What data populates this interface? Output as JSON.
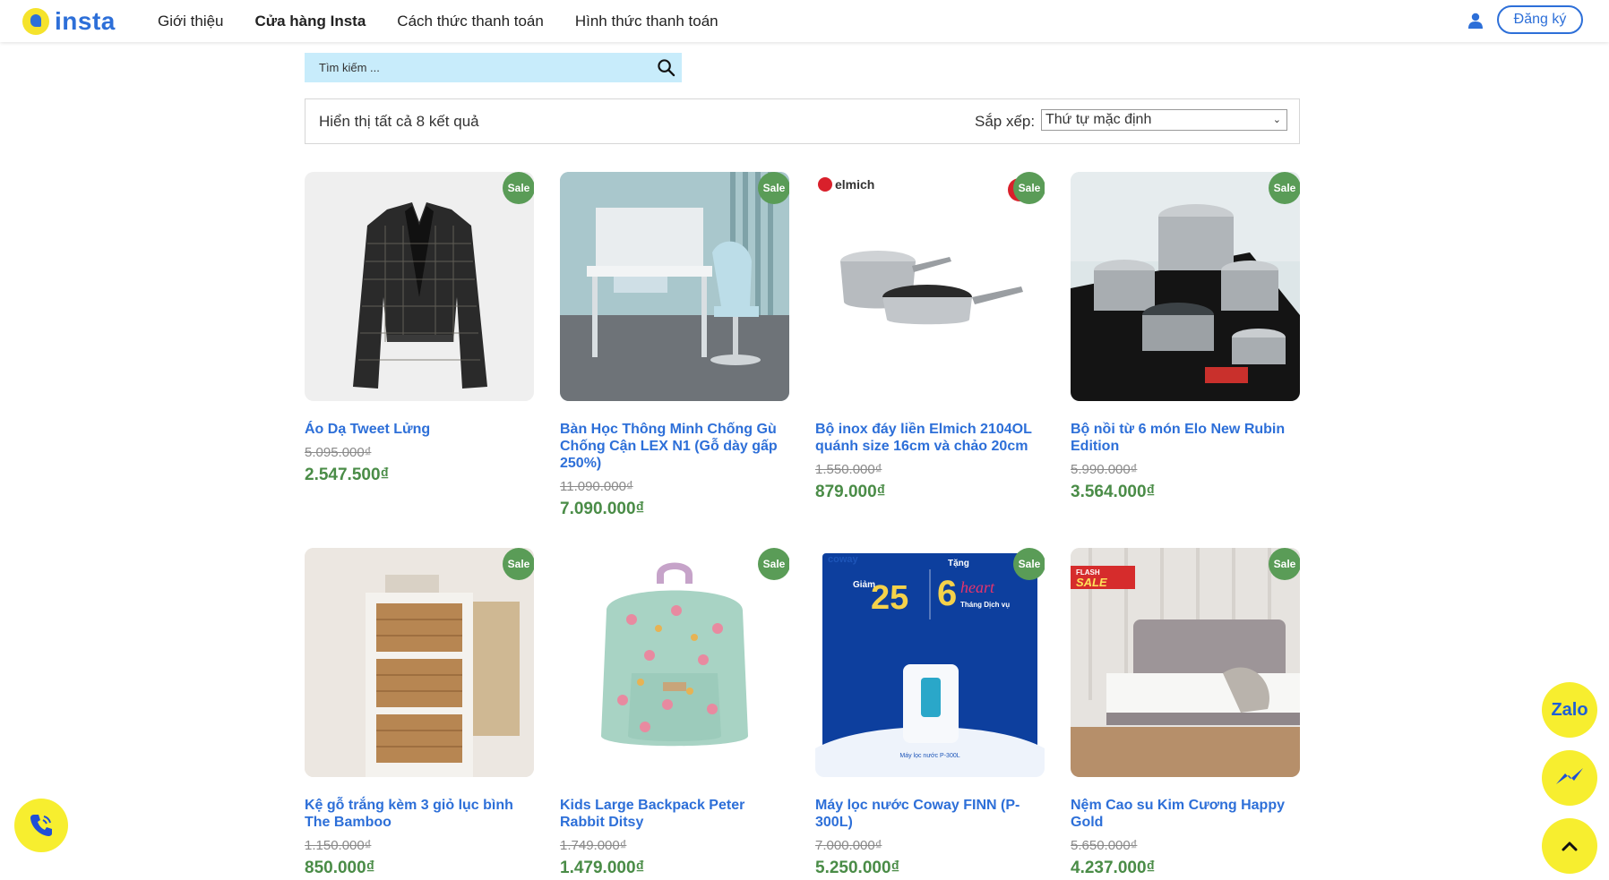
{
  "header": {
    "logo_text": "insta",
    "nav": [
      "Giới thiệu",
      "Cửa hàng Insta",
      "Cách thức thanh toán",
      "Hình thức thanh toán"
    ],
    "active_nav": "Cửa hàng Insta",
    "signup_label": "Đăng ký"
  },
  "search": {
    "placeholder": "Tìm kiếm ..."
  },
  "toolbar": {
    "result_count": "Hiển thị tất cả 8 kết quả",
    "sort_label": "Sắp xếp:",
    "sort_value": "Thứ tự mặc định"
  },
  "sale_badge": "Sale",
  "products": [
    {
      "name": "Áo Dạ Tweet Lửng",
      "old_price": "5.095.000₫",
      "new_price": "2.547.500₫"
    },
    {
      "name": "Bàn Học Thông Minh Chống Gù Chống Cận LEX N1 (Gỗ dày gấp 250%)",
      "old_price": "11.090.000₫",
      "new_price": "7.090.000₫"
    },
    {
      "name": "Bộ inox đáy liền Elmich 2104OL quánh size 16cm và chảo 20cm",
      "old_price": "1.550.000₫",
      "new_price": "879.000₫"
    },
    {
      "name": "Bộ nồi từ 6 món Elo New Rubin Edition",
      "old_price": "5.990.000₫",
      "new_price": "3.564.000₫"
    },
    {
      "name": "Kệ gỗ trắng kèm 3 giỏ lục bình The Bamboo",
      "old_price": "1.150.000₫",
      "new_price": "850.000₫"
    },
    {
      "name": "Kids Large Backpack Peter Rabbit Ditsy",
      "old_price": "1.749.000₫",
      "new_price": "1.479.000₫"
    },
    {
      "name": "Máy lọc nước Coway FINN (P-300L)",
      "old_price": "7.000.000₫",
      "new_price": "5.250.000₫"
    },
    {
      "name": "Nệm Cao su Kim Cương Happy Gold",
      "old_price": "5.650.000₫",
      "new_price": "4.237.000₫"
    }
  ],
  "image_text": {
    "elmich": "elmich",
    "coway": "coway",
    "coway_discount_label": "Giảm",
    "coway_discount": "25",
    "coway_gift_label": "Tặng",
    "coway_gift": "6",
    "coway_heart": "heart",
    "coway_service": "Tháng Dịch vụ",
    "coway_model": "Máy lọc nước P-300L",
    "flash": "FLASH",
    "flash_sale": "SALE"
  },
  "floating": {
    "zalo_label": "Zalo"
  },
  "colors": {
    "brand_blue": "#2d6fd8",
    "sale_green": "#5a9c57",
    "price_green": "#4a8c47",
    "search_bg": "#c8ecfb",
    "fab_yellow": "#f7ee2f"
  },
  "icons": [
    "user-icon",
    "search-icon",
    "phone-icon",
    "messenger-icon",
    "chevron-up-icon"
  ]
}
